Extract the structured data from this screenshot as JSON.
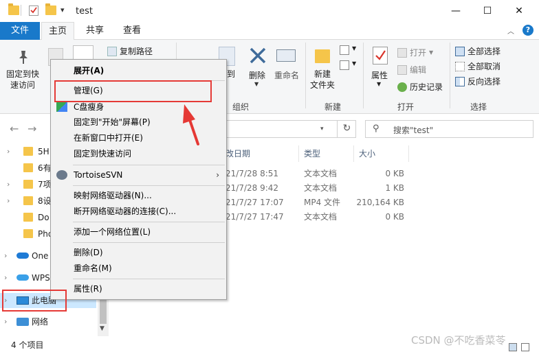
{
  "window": {
    "title": "test",
    "minimize_glyph": "—",
    "maximize_glyph": "☐",
    "close_glyph": "✕"
  },
  "tabs": {
    "file": "文件",
    "home": "主页",
    "share": "共享",
    "view": "查看"
  },
  "ribbon": {
    "pin_quick_access": "固定到快\n速访问",
    "copy_path": "复制路径",
    "move_to": "到",
    "delete": "删除",
    "rename": "重命名",
    "new_folder": "新建\n文件夹",
    "properties": "属性",
    "open": "打开",
    "edit": "编辑",
    "history": "历史记录",
    "select_all": "全部选择",
    "select_none": "全部取消",
    "invert_selection": "反向选择",
    "group_organize": "组织",
    "group_new": "新建",
    "group_open": "打开",
    "group_select": "选择"
  },
  "addressbar": {
    "search_placeholder": "搜索\"test\""
  },
  "navpane": {
    "items": [
      {
        "label": "5H"
      },
      {
        "label": "6有"
      },
      {
        "label": "7项"
      },
      {
        "label": "8设"
      },
      {
        "label": "Do"
      },
      {
        "label": "Pho"
      },
      {
        "label": "One"
      },
      {
        "label": "WPS"
      },
      {
        "label": "此电脑"
      },
      {
        "label": "网络"
      }
    ]
  },
  "filelist": {
    "columns": {
      "date": "改日期",
      "type": "类型",
      "size": "大小"
    },
    "rows": [
      {
        "date": "21/7/28 8:51",
        "type": "文本文档",
        "size": "0 KB"
      },
      {
        "date": "21/7/28 9:42",
        "type": "文本文档",
        "size": "1 KB"
      },
      {
        "date": "21/7/27 17:07",
        "type": "MP4 文件",
        "size": "210,164 KB"
      },
      {
        "date": "21/7/27 17:47",
        "type": "文本文档",
        "size": "0 KB"
      }
    ]
  },
  "statusbar": {
    "item_count": "4 个项目"
  },
  "watermark": "CSDN @不吃香菜苓",
  "context_menu": {
    "items": [
      {
        "label": "展开(A)",
        "bold": true
      },
      {
        "label": "管理(G)"
      },
      {
        "label": "C盘瘦身"
      },
      {
        "label": "固定到\"开始\"屏幕(P)"
      },
      {
        "label": "在新窗口中打开(E)"
      },
      {
        "label": "固定到快速访问"
      },
      {
        "label": "TortoiseSVN"
      },
      {
        "label": "映射网络驱动器(N)..."
      },
      {
        "label": "断开网络驱动器的连接(C)..."
      },
      {
        "label": "添加一个网络位置(L)"
      },
      {
        "label": "删除(D)"
      },
      {
        "label": "重命名(M)"
      },
      {
        "label": "属性(R)"
      }
    ]
  },
  "colors": {
    "accent": "#1979ca",
    "annotation": "#e53935"
  }
}
